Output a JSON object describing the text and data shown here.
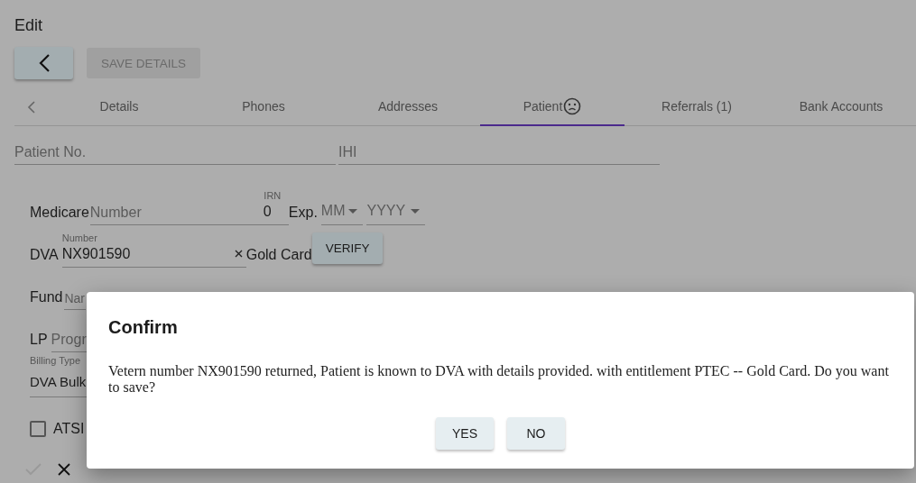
{
  "page_title": "Edit",
  "toolbar": {
    "save_button": {
      "label": "SAVE DETAILS",
      "disabled": true
    }
  },
  "tabs": [
    {
      "label": "Details",
      "selected": false,
      "flagged": false
    },
    {
      "label": "Phones",
      "selected": false,
      "flagged": false
    },
    {
      "label": "Addresses",
      "selected": false,
      "flagged": false
    },
    {
      "label": "Patient",
      "selected": true,
      "flagged": true
    },
    {
      "label": "Referrals (1)",
      "selected": false,
      "flagged": false
    },
    {
      "label": "Bank Accounts",
      "selected": false,
      "flagged": false
    }
  ],
  "form": {
    "patient_no": {
      "placeholder": "Patient No."
    },
    "ihi": {
      "placeholder": "IHI"
    },
    "medicare": {
      "label": "Medicare",
      "number_placeholder": "Number",
      "irn_label": "IRN",
      "irn_value": "0",
      "exp_label": "Exp.",
      "month_placeholder": "MM",
      "year_placeholder": "YYYY"
    },
    "dva": {
      "label": "DVA",
      "number_label": "Number",
      "number_value": "NX901590",
      "card_type": "Gold Card",
      "verify_button": "VERIFY"
    },
    "fund": {
      "label": "Fund",
      "name_placeholder": "Nar"
    },
    "lp": {
      "label": "LP",
      "program_placeholder": "Progr"
    },
    "billing_type": {
      "label": "Billing Type",
      "value": "DVA Bulk"
    },
    "atsi": {
      "label": "ATSI",
      "checked": false
    },
    "accept_disabled": true
  },
  "dialog": {
    "title": "Confirm",
    "message": "Vetern number NX901590 returned, Patient is known to DVA with details provided. with entitlement PTEC -- Gold Card. Do you want to save?",
    "buttons": [
      "YES",
      "NO"
    ]
  }
}
